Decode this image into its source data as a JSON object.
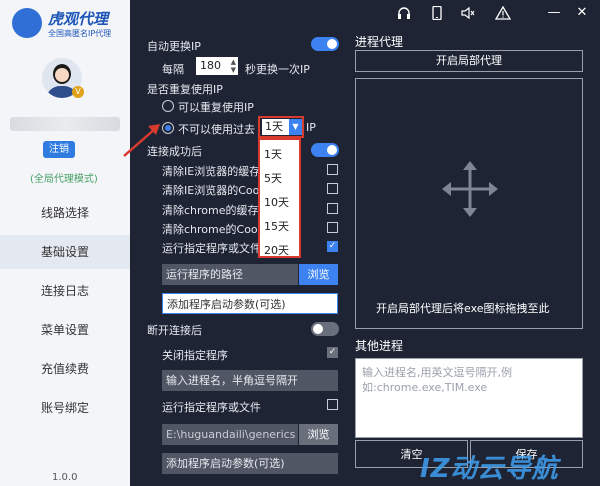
{
  "brand": {
    "name": "虎观代理",
    "tagline": "全国高匿名IP代理"
  },
  "user": {
    "logout_label": "注销",
    "mode_label": "(全局代理模式)",
    "vip_badge": "V"
  },
  "nav": {
    "items": [
      {
        "label": "线路选择"
      },
      {
        "label": "基础设置"
      },
      {
        "label": "连接日志"
      },
      {
        "label": "菜单设置"
      },
      {
        "label": "充值续费"
      },
      {
        "label": "账号绑定"
      }
    ]
  },
  "version": "1.0.0",
  "toolbar_icons": [
    "headset-icon",
    "mobile-icon",
    "speaker-icon",
    "warning-icon"
  ],
  "window": {
    "minimize": "—",
    "close": "✕"
  },
  "settings": {
    "auto_switch_label": "自动更换IP",
    "every_label": "每隔",
    "interval_value": "180",
    "interval_suffix": "秒更换一次IP",
    "repeat_label": "是否重复使用IP",
    "repeat_yes": "可以重复使用IP",
    "repeat_no": "不可以使用过去",
    "repeat_no_suffix": "IP",
    "days_selected": "1天",
    "days_options": [
      "1天",
      "5天",
      "10天",
      "15天",
      "20天"
    ],
    "after_connect_label": "连接成功后",
    "clear_ie_cache": "清除IE浏览器的缓存",
    "clear_ie_cookie": "清除IE浏览器的Coo",
    "clear_chrome_cache": "清除chrome的缓存",
    "clear_chrome_cookie": "清除chrome的Coo",
    "run_program": "运行指定程序或文件",
    "program_path_placeholder": "运行程序的路径",
    "browse_label": "浏览",
    "add_params_placeholder": "添加程序启动参数(可选)",
    "after_disconnect_label": "断开连接后",
    "close_program": "关闭指定程序",
    "process_input_placeholder": "输入进程名，半角逗号隔开",
    "run_program_2": "运行指定程序或文件",
    "path_value": "E:\\huguandaili\\generics",
    "browse_label_2": "浏览",
    "add_params_placeholder_2": "添加程序启动参数(可选)"
  },
  "process_proxy": {
    "title": "进程代理",
    "open_button": "开启局部代理",
    "drop_hint": "开启局部代理后将exe图标拖拽至此",
    "other_title": "其他进程",
    "other_placeholder": "输入进程名,用英文逗号隔开,例如:chrome.exe,TIM.exe",
    "clear_button": "清空",
    "save_button": "保存"
  },
  "watermark": "IZ动云导航",
  "colors": {
    "accent": "#3c82f0",
    "highlight": "#d83a2e",
    "panel_bg": "#1e2434"
  }
}
